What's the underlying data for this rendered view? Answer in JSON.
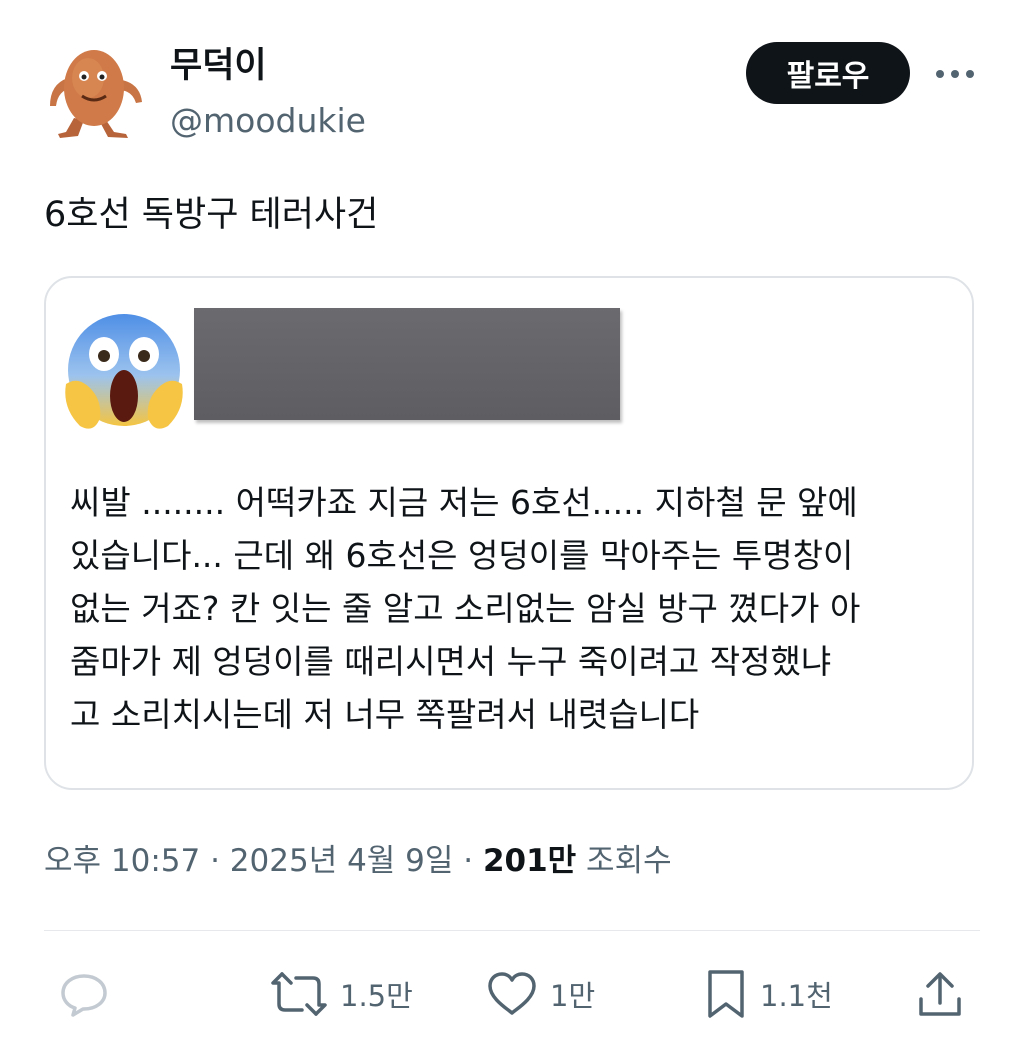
{
  "author": {
    "display_name": "무덕이",
    "handle": "@moodukie"
  },
  "follow_label": "팔로우",
  "tweet": {
    "text": "6호선 독방구 테러사건"
  },
  "quote": {
    "body": "씨발 ........ 어떡카죠 지금 저는 6호선..... 지하철 문 앞에\n있습니다... 근데 왜 6호선은 엉덩이를 막아주는 투명창이\n없는 거죠? 칸 잇는 줄 알고 소리없는 암실 방구 꼈다가 아\n줌마가 제 엉덩이를 때리시면서 누구 죽이려고 작정했냐\n고 소리치시는데 저 너무 쪽팔려서 내렷습니다",
    "avatar_icon": "screaming-face-emoji"
  },
  "meta": {
    "time": "오후 10:57",
    "sep1": " · ",
    "date": "2025년 4월 9일",
    "sep2": " · ",
    "views_count": "201만",
    "views_label": " 조회수"
  },
  "actions": {
    "reply_icon": "reply-icon",
    "retweet_count": "1.5만",
    "like_count": "1만",
    "bookmark_count": "1.1천",
    "share_icon": "share-icon"
  },
  "colors": {
    "text": "#0f1419",
    "secondary": "#536471",
    "follow_bg": "#0f1419",
    "border": "#dfe3e7"
  }
}
